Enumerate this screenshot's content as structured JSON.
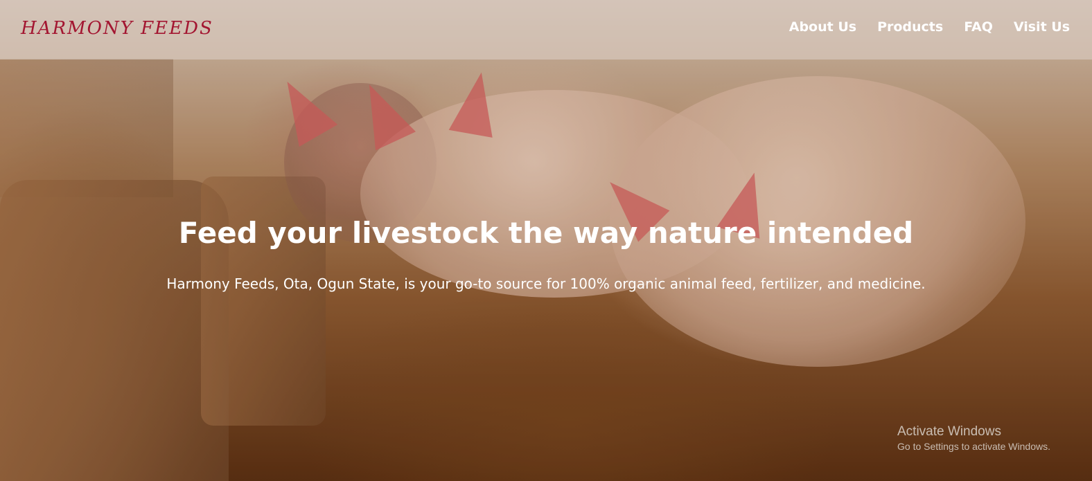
{
  "app": {
    "logo": "HARMONY FEEDS"
  },
  "nav": {
    "items": [
      "About Us",
      "Products",
      "FAQ",
      "Visit Us"
    ]
  },
  "hero": {
    "title": "Feed your livestock the way nature intended",
    "subtitle": "Harmony Feeds, Ota, Ogun State, is your go-to source for 100% organic animal feed, fertilizer, and medicine."
  },
  "watermark": {
    "line1": "Activate Windows",
    "line2": "Go to Settings to activate Windows."
  },
  "colors": {
    "logo": "#a31631",
    "nav_text": "#ffffff",
    "hero_text": "#ffffff"
  }
}
